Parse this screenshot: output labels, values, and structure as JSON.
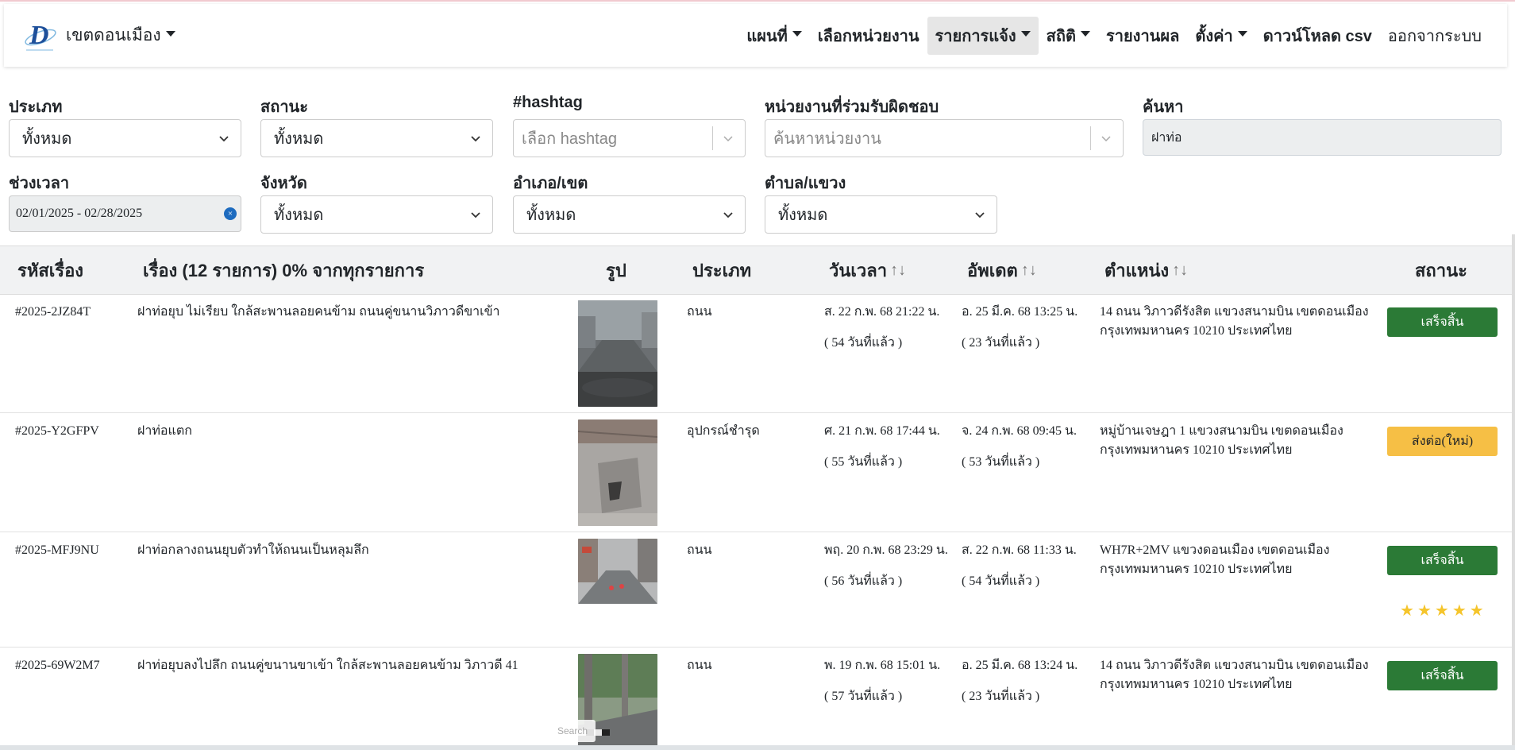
{
  "brand": {
    "name": "เขตดอนเมือง",
    "logo_letter": "D"
  },
  "nav": [
    {
      "label": "แผนที่",
      "dropdown": true,
      "active": false
    },
    {
      "label": "เลือกหน่วยงาน",
      "dropdown": false,
      "active": false
    },
    {
      "label": "รายการแจ้ง",
      "dropdown": true,
      "active": true
    },
    {
      "label": "สถิติ",
      "dropdown": true,
      "active": false
    },
    {
      "label": "รายงานผล",
      "dropdown": false,
      "active": false
    },
    {
      "label": "ตั้งค่า",
      "dropdown": true,
      "active": false
    },
    {
      "label": "ดาวน์โหลด csv",
      "dropdown": false,
      "active": false
    },
    {
      "label": "ออกจากระบบ",
      "dropdown": false,
      "active": false
    }
  ],
  "filters": {
    "type": {
      "label": "ประเภท",
      "value": "ทั้งหมด"
    },
    "status": {
      "label": "สถานะ",
      "value": "ทั้งหมด"
    },
    "hashtag": {
      "label": "#hashtag",
      "placeholder": "เลือก hashtag"
    },
    "agency": {
      "label": "หน่วยงานที่ร่วมรับผิดชอบ",
      "placeholder": "ค้นหาหน่วยงาน"
    },
    "search": {
      "label": "ค้นหา",
      "value": "ฝาท่อ"
    },
    "period": {
      "label": "ช่วงเวลา",
      "value": "02/01/2025 - 02/28/2025"
    },
    "province": {
      "label": "จังหวัด",
      "value": "ทั้งหมด"
    },
    "district": {
      "label": "อำเภอ/เขต",
      "value": "ทั้งหมด"
    },
    "subdistrict": {
      "label": "ตำบล/แขวง",
      "value": "ทั้งหมด"
    }
  },
  "table": {
    "headers": {
      "id": "รหัสเรื่อง",
      "title": "เรื่อง (12 รายการ) 0% จากทุกรายการ",
      "image": "รูป",
      "type": "ประเภท",
      "datetime": "วันเวลา",
      "updated": "อัพเดต",
      "location": "ตำแหน่ง",
      "status": "สถานะ",
      "sort_glyph": "↑↓"
    },
    "rows": [
      {
        "id": "#2025-2JZ84T",
        "title": "ฝาท่อยุบ ไม่เรียบ ใกล้สะพานลอยคนข้าม ถนนคู่ขนานวิภาวดีขาเข้า",
        "type": "ถนน",
        "date": "ส. 22 ก.พ. 68 21:22 น.",
        "date_ago": "( 54 วันที่แล้ว )",
        "updated": "อ. 25 มี.ค. 68 13:25 น.",
        "updated_ago": "( 23 วันที่แล้ว )",
        "location_1": "14 ถนน วิภาวดีรังสิต แขวงสนามบิน เขตดอนเมือง",
        "location_2": "กรุงเทพมหานคร 10210 ประเทศไทย",
        "status": "เสร็จสิ้น",
        "status_color": "#2b7a36"
      },
      {
        "id": "#2025-Y2GFPV",
        "title": "ฝาท่อแตก",
        "type": "อุปกรณ์ชำรุด",
        "date": "ศ. 21 ก.พ. 68 17:44 น.",
        "date_ago": "( 55 วันที่แล้ว )",
        "updated": "จ. 24 ก.พ. 68 09:45 น.",
        "updated_ago": "( 53 วันที่แล้ว )",
        "location_1": "หมู่บ้านเจษฎา 1 แขวงสนามบิน เขตดอนเมือง",
        "location_2": "กรุงเทพมหานคร 10210 ประเทศไทย",
        "status": "ส่งต่อ(ใหม่)",
        "status_color": "#f6bf45"
      },
      {
        "id": "#2025-MFJ9NU",
        "title": "ฝาท่อกลางถนนยุบตัวทำให้ถนนเป็นหลุมลึก",
        "type": "ถนน",
        "date": "พฤ. 20 ก.พ. 68 23:29 น.",
        "date_ago": "( 56 วันที่แล้ว )",
        "updated": "ส. 22 ก.พ. 68 11:33 น.",
        "updated_ago": "( 54 วันที่แล้ว )",
        "location_1": "WH7R+2MV แขวงดอนเมือง เขตดอนเมือง",
        "location_2": "กรุงเทพมหานคร 10210 ประเทศไทย",
        "status": "เสร็จสิ้น",
        "status_color": "#2b7a36",
        "rating": 5
      },
      {
        "id": "#2025-69W2M7",
        "title": "ฝาท่อยุบลงไปลึก ถนนคู่ขนานขาเข้า ใกล้สะพานลอยคนข้าม วิภาวดี 41",
        "type": "ถนน",
        "date": "พ. 19 ก.พ. 68 15:01 น.",
        "date_ago": "( 57 วันที่แล้ว )",
        "updated": "อ. 25 มี.ค. 68 13:24 น.",
        "updated_ago": "( 23 วันที่แล้ว )",
        "location_1": "14 ถนน วิภาวดีรังสิต แขวงสนามบิน เขตดอนเมือง",
        "location_2": "กรุงเทพมหานคร 10210 ประเทศไทย",
        "status": "เสร็จสิ้น",
        "status_color": "#2b7a36"
      }
    ]
  },
  "search_ghost": "Search"
}
